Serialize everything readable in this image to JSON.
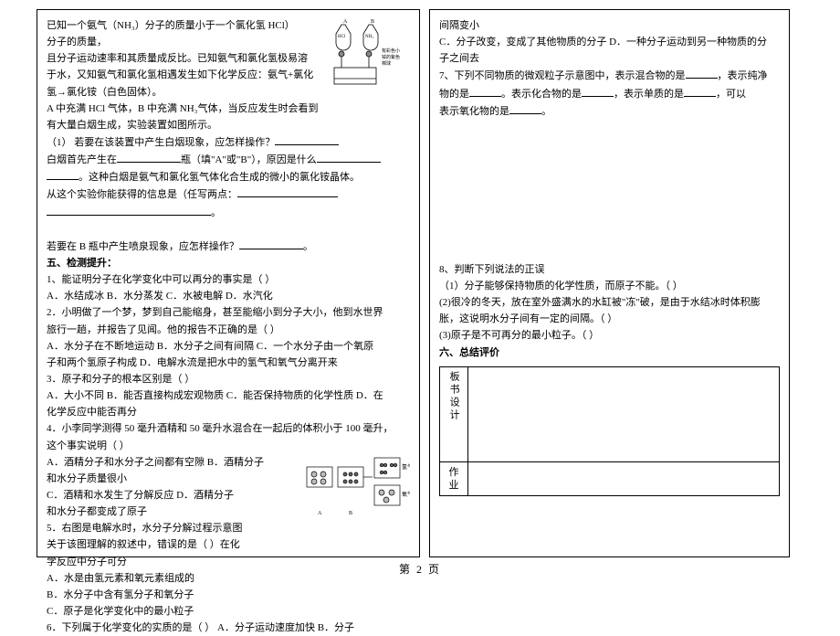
{
  "page_number": "第 2 页",
  "left": {
    "intro_l1": "已知一个氨气（NH₃）分子的质量小于一个氯化氢 HCl）",
    "intro_l2": "分子的质量，",
    "intro_l3": "且分子运动速率和其质量成反比。已知氨气和氯化氢极易溶",
    "intro_l4": "于水，又知氨气和氯化氢相遇发生如下化学反应：氨气+氯化",
    "intro_l5": "氢→氯化铵（白色固体）。",
    "intro_l6": "A 中充满 HCl 气体，B 中充满 NH₃气体，当反应发生时会看到",
    "intro_l7": "有大量白烟生成，实验装置如图所示。",
    "q1_prefix": "（1） 若要在该装置中产生白烟现象，应怎样操作？",
    "q1_line2a": "白烟首先产生在",
    "q1_line2b": "瓶（填\"A\"或\"B\"），原因是什么",
    "q1_line3a": "。这种白烟是氨气和氯化氢气体化合生成的微小的氯化铵晶体。",
    "q1_line4a": "从这个实验你能获得的信息是（任写两点：",
    "q1_line5": "。",
    "q2": "若要在 B 瓶中产生喷泉现象，应怎样操作？",
    "sec5_title": "五、检测提升：",
    "q5_1": "1、能证明分子在化学变化中可以再分的事实是（   ）",
    "q5_1_opts": "A．水结成冰 B．水分蒸发 C．水被电解 D．水汽化",
    "q5_2a": "2．小明做了一个梦，梦到自己能缩身，甚至能缩小到分子大小，他到水世界",
    "q5_2b": "旅行一趟，并报告了见闻。他的报告不正确的是（     ）",
    "q5_2_opts_a": "A．水分子在不断地运动   B．水分子之间有间隔   C．一个水分子由一个氧原",
    "q5_2_opts_b": "子和两个氢原子构成   D．电解水流是把水中的氢气和氧气分离开来",
    "q5_3": "3．原子和分子的根本区别是（   ）",
    "q5_3_opts_a": "A．大小不同   B．能否直接构成宏观物质   C．能否保持物质的化学性质   D．在",
    "q5_3_opts_b": "化学反应中能否再分",
    "q5_4a": "4．小李同学测得 50 毫升酒精和 50 毫升水混合在一起后的体积小于 100 毫升，",
    "q5_4b": "这个事实说明（     ）",
    "q5_4_opts_a": "A．酒精分子和水分子之间都有空隙   B．酒精分子",
    "q5_4_opts_b": "和水分子质量很小",
    "q5_4_opts_c": "C．酒精和水发生了分解反应         D．酒精分子",
    "q5_4_opts_d": "和水分子都变成了原子",
    "q5_5a": "5．右图是电解水时，水分子分解过程示意图",
    "q5_5b": "关于该图理解的叙述中，错误的是（     ）在化",
    "q5_5c": "学反应中分子可分",
    "q5_5_opts_a": "A．水是由氢元素和氧元素组成的",
    "q5_5_opts_b": "B．水分子中含有氢分子和氧分子",
    "q5_5_opts_c": "C．原子是化学变化中的最小粒子",
    "q5_6": "6．下列属于化学变化的实质的是（     ）    A．分子运动速度加快     B．分子",
    "apparatus_label_a": "A",
    "apparatus_label_b": "B",
    "apparatus_side": "有彩色小铵的紫色棉球",
    "diagram2_top": "氢气",
    "diagram2_bottom": "氧气"
  },
  "right": {
    "cont_l1": "间隔变小",
    "cont_l2": "C．分子改变，变成了其他物质的分子   D．一种分子运动到另一种物质的分",
    "cont_l3": "子之间去",
    "q7a": "7、下列不同物质的微观粒子示意图中，表示混合物的是",
    "q7b": "物的是",
    "q7c": "。表示化合物的是",
    "q7d": "，表示单质的是",
    "q7e": "，可以",
    "q7f": "表示氧化物的是",
    "q7g": "，表示纯净",
    "q8": "8、判断下列说法的正误",
    "q8_1": "（1）分子能够保持物质的化学性质，而原子不能。（    ）",
    "q8_2a": "(2)很冷的冬天，放在室外盛满水的水缸被\"冻\"破，是由于水结冰时体积膨",
    "q8_2b": "胀，这说明水分子间有一定的间隔。（    ）",
    "q8_3": "(3)原子是不可再分的最小粒子。（    ）",
    "sec6_title": "六、总结评价",
    "table_label1": "板书设计",
    "table_label2": "作业"
  }
}
